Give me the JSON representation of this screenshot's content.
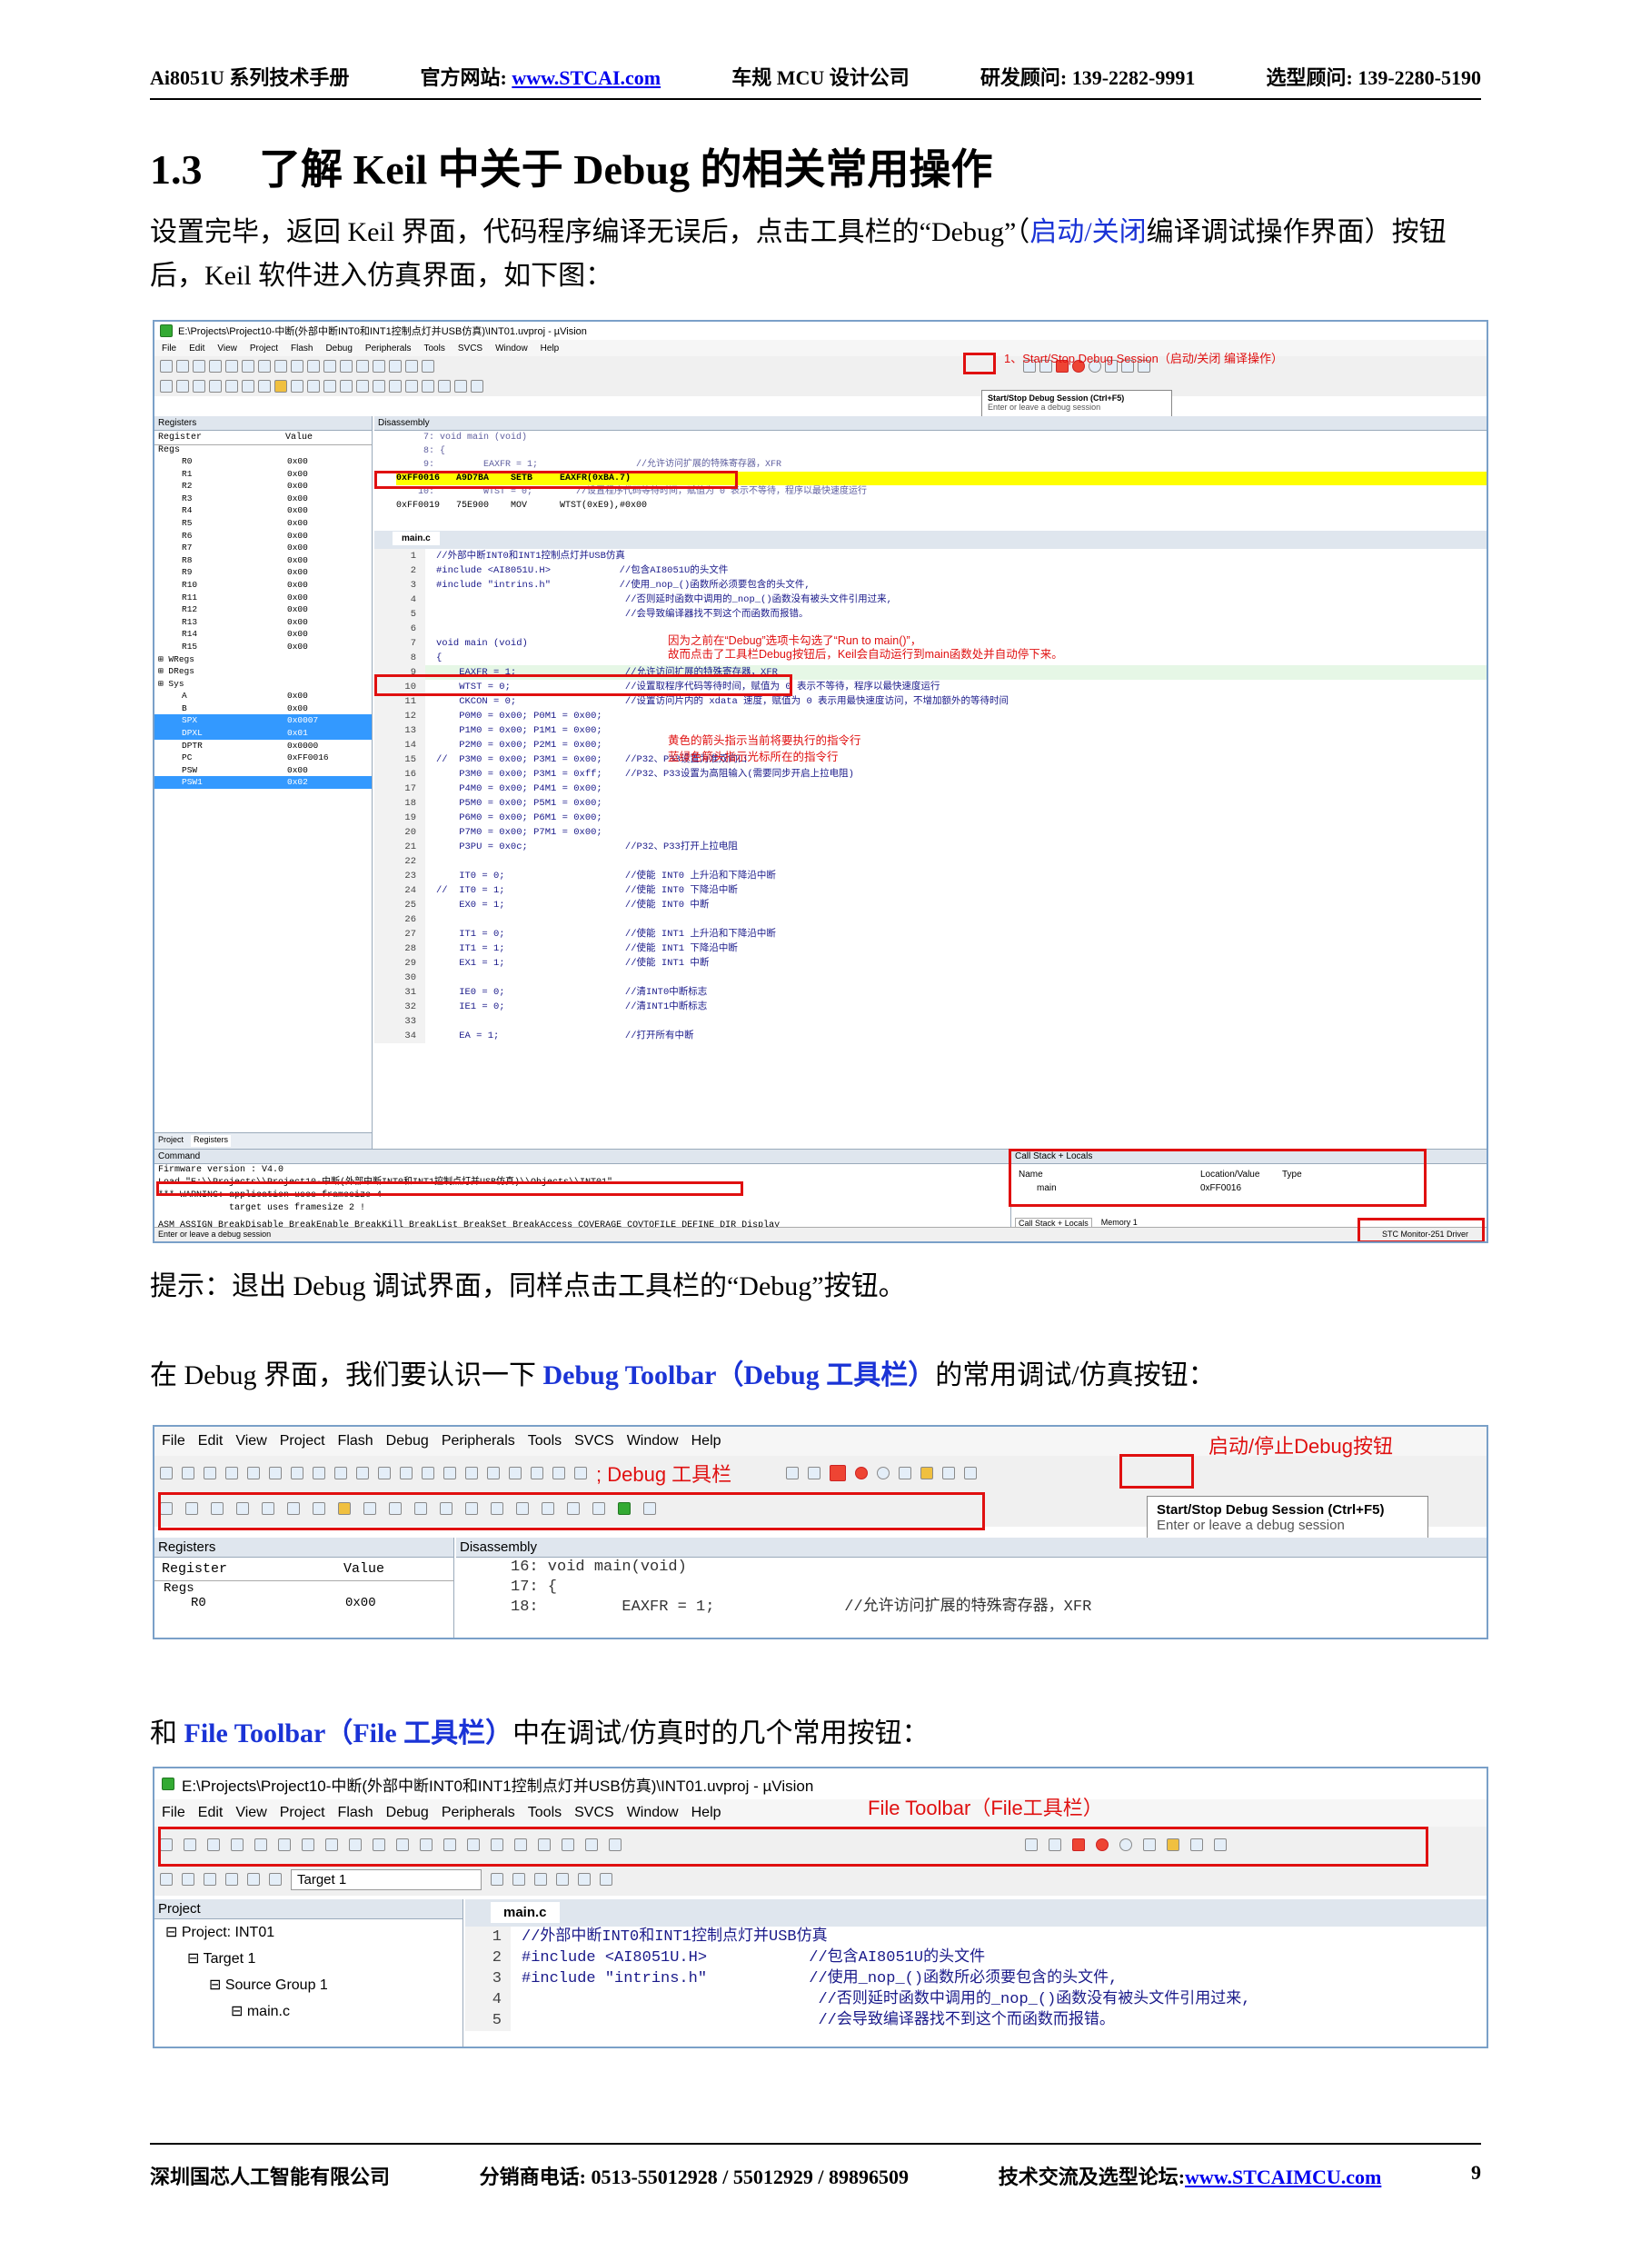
{
  "header": {
    "manual": "Ai8051U 系列技术手册",
    "site_label": "官方网站:",
    "site_url": "www.STCAI.com",
    "company_tag": "车规 MCU 设计公司",
    "rd_label": "研发顾问:",
    "rd_phone": "139-2282-9991",
    "sel_label": "选型顾问:",
    "sel_phone": "139-2280-5190"
  },
  "section": {
    "number": "1.3",
    "title": "了解 Keil 中关于 Debug 的相关常用操作"
  },
  "para1": {
    "a": "设置完毕，返回 Keil 界面，代码程序编译无误后，点击工具栏的“Debug”（",
    "b": "启动/关闭",
    "c": "编译调试操作界面）按钮后，Keil 软件进入仿真界面，如下图："
  },
  "shot1": {
    "window_title": "E:\\Projects\\Project10-中断(外部中断INT0和INT1控制点灯并USB仿真)\\INT01.uvproj - µVision",
    "menu": [
      "File",
      "Edit",
      "View",
      "Project",
      "Flash",
      "Debug",
      "Peripherals",
      "Tools",
      "SVCS",
      "Window",
      "Help"
    ],
    "note_start_stop": "1、Start/Stop Debug Session（启动/关闭 编译操作）",
    "tooltip_title": "Start/Stop Debug Session (Ctrl+F5)",
    "tooltip_sub": "Enter or leave a debug session",
    "registers_title": "Registers",
    "reg_col1": "Register",
    "reg_col2": "Value",
    "reg_group": "Regs",
    "registers": [
      [
        "R0",
        "0x00"
      ],
      [
        "R1",
        "0x00"
      ],
      [
        "R2",
        "0x00"
      ],
      [
        "R3",
        "0x00"
      ],
      [
        "R4",
        "0x00"
      ],
      [
        "R5",
        "0x00"
      ],
      [
        "R6",
        "0x00"
      ],
      [
        "R7",
        "0x00"
      ],
      [
        "R8",
        "0x00"
      ],
      [
        "R9",
        "0x00"
      ],
      [
        "R10",
        "0x00"
      ],
      [
        "R11",
        "0x00"
      ],
      [
        "R12",
        "0x00"
      ],
      [
        "R13",
        "0x00"
      ],
      [
        "R14",
        "0x00"
      ],
      [
        "R15",
        "0x00"
      ]
    ],
    "reg_groups2": [
      "WRegs",
      "DRegs",
      "Sys"
    ],
    "sys_regs": [
      [
        "A",
        "0x00"
      ],
      [
        "B",
        "0x00"
      ],
      [
        "SPX",
        "0x0007"
      ],
      [
        "DPXL",
        "0x01"
      ],
      [
        "DPTR",
        "0x0000"
      ],
      [
        "PC",
        "0xFF0016"
      ],
      [
        "PSW",
        "0x00"
      ],
      [
        "PSW1",
        "0x02"
      ]
    ],
    "disasm_title": "Disassembly",
    "disasm_lines": [
      "     7: void main (void)",
      "     8: {",
      "     9:         EAXFR = 1;                  //允许访问扩展的特殊寄存器，XFR",
      "0xFF0016   A9D7BA    SETB     EAXFR(0xBA.7)",
      "    10:         WTST = 0;        //设置程序代码等待时间，赋值为 0 表示不等待，程序以最快速度运行",
      "0xFF0019   75E900    MOV      WTST(0xE9),#0x00"
    ],
    "tab_main": "main.c",
    "code_lines": [
      [
        "1",
        "//外部中断INT0和INT1控制点灯并USB仿真"
      ],
      [
        "2",
        "#include <AI8051U.H>            //包含AI8051U的头文件"
      ],
      [
        "3",
        "#include \"intrins.h\"            //使用_nop_()函数所必须要包含的头文件,"
      ],
      [
        "4",
        "                                 //否则延时函数中调用的_nop_()函数没有被头文件引用过来,"
      ],
      [
        "5",
        "                                 //会导致编译器找不到这个而函数而报错。"
      ],
      [
        "6",
        ""
      ],
      [
        "7",
        "void main (void)"
      ],
      [
        "8",
        "{"
      ],
      [
        "9",
        "    EAXFR = 1;                   //允许访问扩展的特殊寄存器，XFR"
      ],
      [
        "10",
        "    WTST = 0;                    //设置取程序代码等待时间，赋值为 0 表示不等待，程序以最快速度运行"
      ],
      [
        "11",
        "    CKCON = 0;                   //设置访问片内的 xdata 速度，赋值为 0 表示用最快速度访问，不增加额外的等待时间"
      ],
      [
        "12",
        "    P0M0 = 0x00; P0M1 = 0x00;"
      ],
      [
        "13",
        "    P1M0 = 0x00; P1M1 = 0x00;"
      ],
      [
        "14",
        "    P2M0 = 0x00; P2M1 = 0x00;"
      ],
      [
        "15",
        "//  P3M0 = 0x00; P3M1 = 0x00;    //P32、P33设置为准双向口"
      ],
      [
        "16",
        "    P3M0 = 0x00; P3M1 = 0xff;    //P32、P33设置为高阻输入(需要同步开启上拉电阻)"
      ],
      [
        "17",
        "    P4M0 = 0x00; P4M1 = 0x00;"
      ],
      [
        "18",
        "    P5M0 = 0x00; P5M1 = 0x00;"
      ],
      [
        "19",
        "    P6M0 = 0x00; P6M1 = 0x00;"
      ],
      [
        "20",
        "    P7M0 = 0x00; P7M1 = 0x00;"
      ],
      [
        "21",
        "    P3PU = 0x0c;                 //P32、P33打开上拉电阻"
      ],
      [
        "22",
        ""
      ],
      [
        "23",
        "    IT0 = 0;                     //使能 INT0 上升沿和下降沿中断"
      ],
      [
        "24",
        "//  IT0 = 1;                     //使能 INT0 下降沿中断"
      ],
      [
        "25",
        "    EX0 = 1;                     //使能 INT0 中断"
      ],
      [
        "26",
        ""
      ],
      [
        "27",
        "    IT1 = 0;                     //使能 INT1 上升沿和下降沿中断"
      ],
      [
        "28",
        "    IT1 = 1;                     //使能 INT1 下降沿中断"
      ],
      [
        "29",
        "    EX1 = 1;                     //使能 INT1 中断"
      ],
      [
        "30",
        ""
      ],
      [
        "31",
        "    IE0 = 0;                     //清INT0中断标志"
      ],
      [
        "32",
        "    IE1 = 0;                     //清INT1中断标志"
      ],
      [
        "33",
        ""
      ],
      [
        "34",
        "    EA = 1;                      //打开所有中断"
      ]
    ],
    "note_run_to_main": "因为之前在“Debug”选项卡勾选了“Run to main()”，\n故而点击了工具栏Debug按钮后，Keil会自动运行到main函数处并自动停下来。",
    "note_arrows": "黄色的箭头指示当前将要执行的指令行\n蓝绿色箭头指示光标所在的指令行",
    "tab_project": "Project",
    "tab_registers": "Registers",
    "command_title": "Command",
    "command_lines": [
      "Firmware version : V4.0",
      "Load \"E:\\\\Projects\\\\Project10-中断(外部中断INT0和INT1控制点灯并USB仿真)\\\\Objects\\\\INT01\"",
      "*** WARNING: application uses framesize 4",
      "             target uses framesize 2 !"
    ],
    "command_hint": "ASM ASSIGN BreakDisable BreakEnable BreakKill BreakList BreakSet BreakAccess COVERAGE COVTOFILE DEFINE DIR Display",
    "callstack_title": "Call Stack + Locals",
    "cs_col_name": "Name",
    "cs_col_loc": "Location/Value",
    "cs_col_type": "Type",
    "cs_row_name": "main",
    "cs_row_loc": "0xFF0016",
    "cs_tab1": "Call Stack + Locals",
    "cs_tab2": "Memory 1",
    "status_left": "Enter or leave a debug session",
    "status_right": "STC Monitor-251 Driver"
  },
  "tip": "提示：退出 Debug 调试界面，同样点击工具栏的“Debug”按钮。",
  "para2": {
    "a": "在 Debug 界面，我们要认识一下 ",
    "b": "Debug Toolbar（Debug 工具栏）",
    "c": "的常用调试/仿真按钮："
  },
  "shot2": {
    "menu": [
      "File",
      "Edit",
      "View",
      "Project",
      "Flash",
      "Debug",
      "Peripherals",
      "Tools",
      "SVCS",
      "Window",
      "Help"
    ],
    "label_toolbar": "; Debug 工具栏",
    "label_start_stop": "启动/停止Debug按钮",
    "tooltip_title": "Start/Stop Debug Session (Ctrl+F5)",
    "tooltip_sub": "Enter or leave a debug session",
    "registers_title": "Registers",
    "reg_col1": "Register",
    "reg_col2": "Value",
    "reg_group": "Regs",
    "reg_row": [
      "R0",
      "0x00"
    ],
    "disasm_title": "Disassembly",
    "disasm_lines": [
      "16: void main(void)",
      "17: {",
      "18:         EAXFR = 1;              //允许访问扩展的特殊寄存器，XFR"
    ]
  },
  "para3": {
    "a": "和 ",
    "b": "File Toolbar（File 工具栏）",
    "c": "中在调试/仿真时的几个常用按钮："
  },
  "shot3": {
    "window_title": "E:\\Projects\\Project10-中断(外部中断INT0和INT1控制点灯并USB仿真)\\INT01.uvproj - µVision",
    "menu": [
      "File",
      "Edit",
      "View",
      "Project",
      "Flash",
      "Debug",
      "Peripherals",
      "Tools",
      "SVCS",
      "Window",
      "Help"
    ],
    "label_toolbar": "File Toolbar（File工具栏）",
    "target": "Target 1",
    "project_title": "Project",
    "tree": [
      "Project: INT01",
      "Target 1",
      "Source Group 1",
      "main.c"
    ],
    "tab_main": "main.c",
    "code_lines": [
      [
        "1",
        "//外部中断INT0和INT1控制点灯并USB仿真"
      ],
      [
        "2",
        "#include <AI8051U.H>           //包含AI8051U的头文件"
      ],
      [
        "3",
        "#include \"intrins.h\"           //使用_nop_()函数所必须要包含的头文件,"
      ],
      [
        "4",
        "                                //否则延时函数中调用的_nop_()函数没有被头文件引用过来,"
      ],
      [
        "5",
        "                                //会导致编译器找不到这个而函数而报错。"
      ]
    ]
  },
  "footer": {
    "company": "深圳国芯人工智能有限公司",
    "dist_label": "分销商电话:",
    "dist_phone": "0513-55012928 / 55012929 / 89896509",
    "forum_label": "技术交流及选型论坛:",
    "forum_url": "www.STCAIMCU.com",
    "page": "9"
  }
}
